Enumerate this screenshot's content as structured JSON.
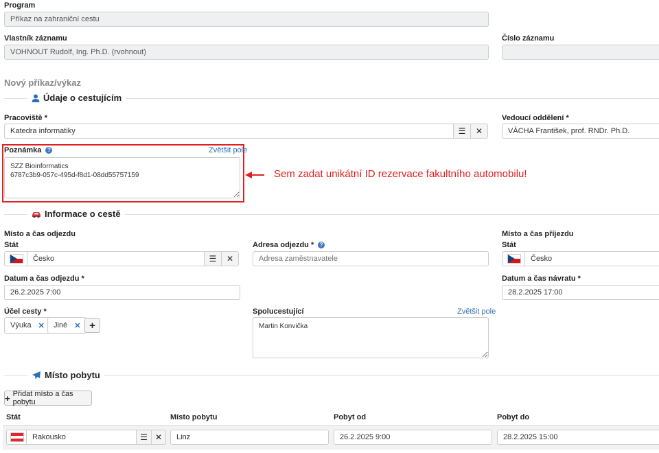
{
  "program": {
    "label": "Program",
    "value": "Příkaz na zahraniční cestu"
  },
  "owner": {
    "label": "Vlastník záznamu",
    "value": "VOHNOUT Rudolf, Ing. Ph.D. (rvohnout)"
  },
  "record_number": {
    "label": "Číslo záznamu",
    "value": ""
  },
  "new_order_heading": "Nový příkaz/výkaz",
  "traveler_section": {
    "title": "Údaje o cestujícím",
    "icon": "user-icon",
    "department": {
      "label": "Pracoviště *",
      "value": "Katedra informatiky",
      "list_btn": "☰",
      "clear_btn": "✕"
    },
    "head": {
      "label": "Vedoucí oddělení *",
      "value": "VÁCHA František, prof. RNDr. Ph.D."
    },
    "note": {
      "label": "Poznámka",
      "help": "?",
      "expand_link": "Zvětšit pole",
      "value": "SZZ Bioinformatics\n6787c3b9-057c-495d-f8d1-08dd55757159"
    },
    "annotation": "Sem zadat unikátní ID rezervace fakultního automobilu!",
    "annotation_color": "#e02020"
  },
  "trip_section": {
    "title": "Informace o cestě",
    "icon": "car-icon",
    "departure": {
      "group_label": "Místo a čas odjezdu",
      "country_label": "Stát",
      "country_value": "Česko",
      "address_label": "Adresa odjezdu *",
      "address_help": "?",
      "address_placeholder": "Adresa zaměstnavatele",
      "datetime_label": "Datum a čas odjezdu *",
      "datetime_value": "26.2.2025 7:00"
    },
    "arrival": {
      "group_label": "Místo a čas příjezdu",
      "country_label": "Stát",
      "country_value": "Česko",
      "datetime_label": "Datum a čas návratu *",
      "datetime_value": "28.2.2025 17:00"
    },
    "purpose": {
      "label": "Účel cesty *",
      "tags": [
        "Výuka",
        "Jiné"
      ],
      "remove_glyph": "✕",
      "add_glyph": "+"
    },
    "companions": {
      "label": "Spolucestující",
      "expand_link": "Zvětšit pole",
      "value": "Martin Konvička"
    }
  },
  "stay_section": {
    "title": "Místo pobytu",
    "icon": "airplane-icon",
    "add_button": "Přidat místo a čas pobytu",
    "add_glyph": "+",
    "columns": [
      "Stát",
      "Místo pobytu",
      "Pobyt od",
      "Pobyt do"
    ],
    "rows": [
      {
        "country": "Rakousko",
        "place": "Linz",
        "from": "26.2.2025 9:00",
        "to": "28.2.2025 15:00"
      }
    ]
  }
}
